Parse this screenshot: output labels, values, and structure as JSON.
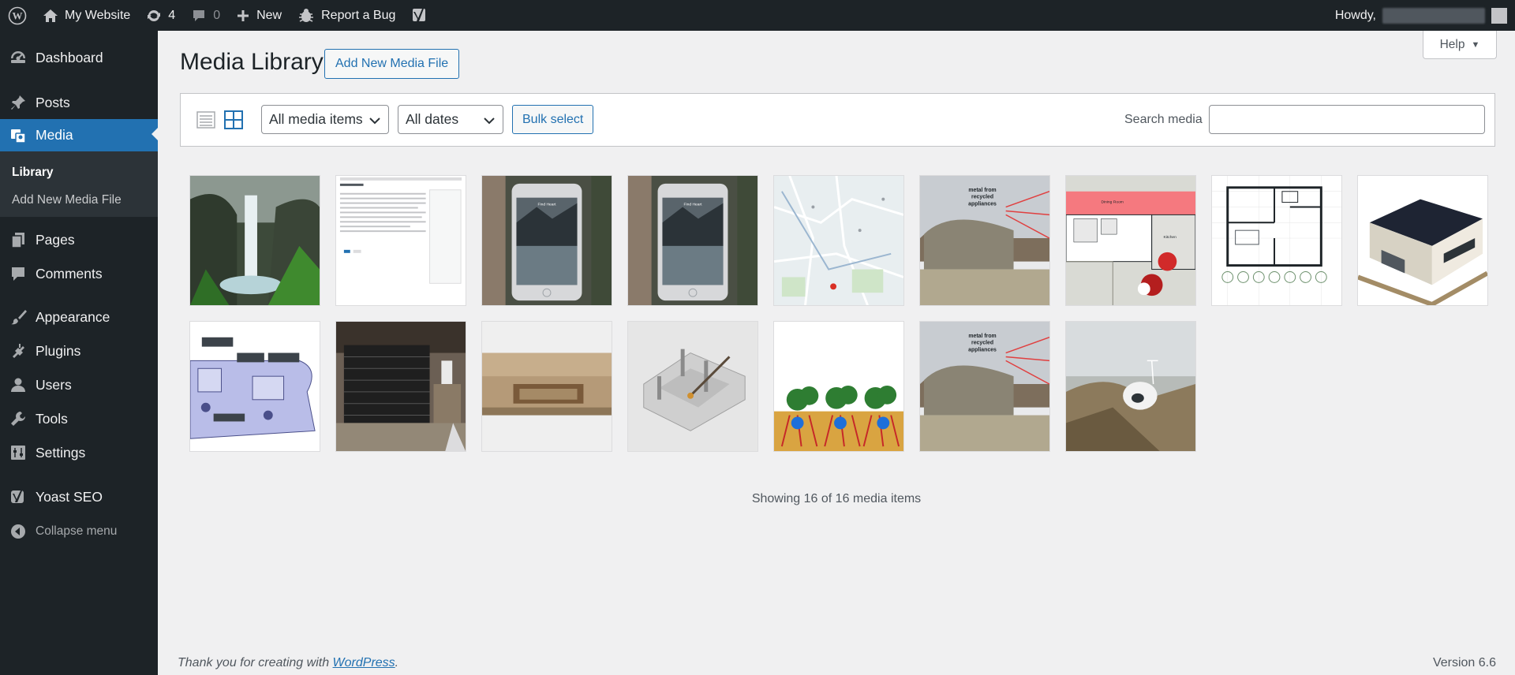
{
  "adminbar": {
    "site_name": "My Website",
    "updates_count": "4",
    "comments_count": "0",
    "new_label": "New",
    "report_bug_label": "Report a Bug",
    "howdy_label": "Howdy,"
  },
  "menu": {
    "items": [
      {
        "label": "Dashboard",
        "icon": "dashboard-icon"
      },
      {
        "label": "Posts",
        "icon": "pin-icon"
      },
      {
        "label": "Media",
        "icon": "media-icon"
      },
      {
        "label": "Pages",
        "icon": "page-icon"
      },
      {
        "label": "Comments",
        "icon": "comment-icon"
      },
      {
        "label": "Appearance",
        "icon": "brush-icon"
      },
      {
        "label": "Plugins",
        "icon": "plug-icon"
      },
      {
        "label": "Users",
        "icon": "user-icon"
      },
      {
        "label": "Tools",
        "icon": "wrench-icon"
      },
      {
        "label": "Settings",
        "icon": "settings-icon"
      },
      {
        "label": "Yoast SEO",
        "icon": "yoast-icon"
      }
    ],
    "submenu": [
      "Library",
      "Add New Media File"
    ],
    "collapse_label": "Collapse menu"
  },
  "help_label": "Help",
  "page_title": "Media Library",
  "add_new_label": "Add New Media File",
  "toolbar": {
    "type_filter": "All media items",
    "date_filter": "All dates",
    "bulk_select_label": "Bulk select",
    "search_label": "Search media",
    "search_value": ""
  },
  "media": [
    {
      "subject": "waterfall"
    },
    {
      "subject": "document screenshot"
    },
    {
      "subject": "phone mockup"
    },
    {
      "subject": "phone mockup"
    },
    {
      "subject": "map"
    },
    {
      "subject": "earthship diagram"
    },
    {
      "subject": "floor plan colored"
    },
    {
      "subject": "floor plan"
    },
    {
      "subject": "3d house"
    },
    {
      "subject": "plan diagram"
    },
    {
      "subject": "construction"
    },
    {
      "subject": "earth building"
    },
    {
      "subject": "3d maze model"
    },
    {
      "subject": "plant roots diagram"
    },
    {
      "subject": "earthship diagram"
    },
    {
      "subject": "pod on mountain"
    }
  ],
  "thumb_labels": {
    "recycled": [
      "metal from",
      "recycled",
      "appliances"
    ],
    "find_heart": "Find Heart",
    "dining": "Dining Room",
    "kitchen": "Kitchen"
  },
  "showing_text": "Showing 16 of 16 media items",
  "footer": {
    "thanks_prefix": "Thank you for creating with ",
    "wordpress_link": "WordPress",
    "thanks_suffix": ".",
    "version": "Version 6.6"
  }
}
